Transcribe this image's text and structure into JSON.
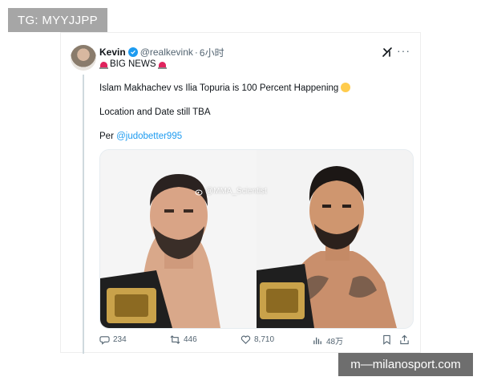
{
  "overlays": {
    "top_tag": "TG: MYYJJPP",
    "bottom_tag": "m—milanosport.com"
  },
  "tweet": {
    "author_name": "Kevin",
    "handle": "@realkevink",
    "separator": "·",
    "time": "6小时",
    "headline": "BIG NEWS",
    "body_line": "Islam Makhachev vs Ilia Topuria is 100 Percent Happening",
    "status_line": "Location and Date still TBA",
    "per_prefix": "Per ",
    "per_mention": "@judobetter995",
    "image_watermark": "@MMA_Scientist"
  },
  "actions": {
    "replies": "234",
    "reposts": "446",
    "likes": "8,710",
    "views": "48万"
  },
  "icons": [
    "avatar",
    "verified-badge-icon",
    "grok-icon",
    "more-icon",
    "siren-icon",
    "flushed-face-icon",
    "weibo-icon",
    "reply-icon",
    "repost-icon",
    "like-icon",
    "views-icon",
    "bookmark-icon",
    "share-icon"
  ],
  "colors": {
    "accent_blue": "#1d9bf0",
    "text": "#0f1419",
    "muted": "#536471",
    "siren": "#e0245e"
  }
}
